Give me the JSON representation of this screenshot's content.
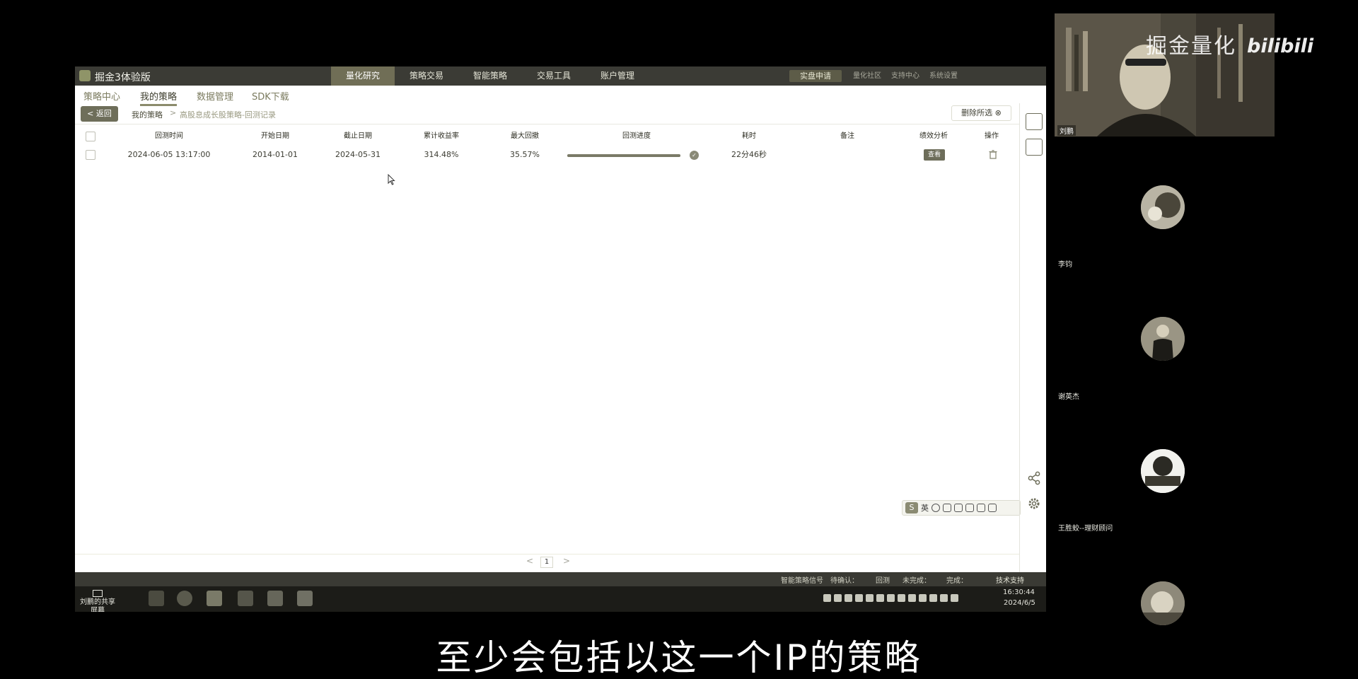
{
  "app": {
    "title": "掘金3体验版",
    "top_tabs": [
      "量化研究",
      "策略交易",
      "智能策略",
      "交易工具",
      "账户管理"
    ],
    "active_top_tab": 0,
    "live_button": "实盘申请",
    "top_links": [
      "量化社区",
      "支持中心",
      "系统设置"
    ]
  },
  "subnav": {
    "items": [
      "策略中心",
      "我的策略",
      "数据管理",
      "SDK下载"
    ],
    "active": 1
  },
  "breadcrumb": {
    "back_label": "< 返回",
    "my_strategy": "我的策略",
    "separator": ">",
    "current": "高股息成长股策略-回测记录",
    "delete_selected": "删除所选 ⊗"
  },
  "table": {
    "headers": [
      "回测时间",
      "开始日期",
      "截止日期",
      "累计收益率",
      "最大回撤",
      "回测进度",
      "耗时",
      "备注",
      "绩效分析",
      "操作"
    ],
    "rows": [
      {
        "backtest_time": "2024-06-05 13:17:00",
        "start_date": "2014-01-01",
        "end_date": "2024-05-31",
        "cumulative_return": "314.48%",
        "max_drawdown": "35.57%",
        "progress": 1.0,
        "elapsed": "22分46秒",
        "note": "",
        "view_label": "查看"
      }
    ]
  },
  "pager": {
    "prev": "<",
    "current": "1",
    "next": ">"
  },
  "statusbar": {
    "items": [
      "智能策略信号",
      "待确认：",
      "回测",
      "未完成：",
      "完成："
    ],
    "tech_support": "技术支持"
  },
  "taskbar": {
    "screenshare_label": "刘鹏的共享屏幕",
    "time": "16:30:44",
    "date": "2024/6/5"
  },
  "ime": {
    "logo": "S",
    "mode": "英"
  },
  "video": {
    "host_name": "刘鹏",
    "watermark": "掘金量化",
    "brand": "bilibili",
    "participants": [
      "李钧",
      "谢英杰",
      "王胜蛟--理财顾问",
      ""
    ]
  },
  "subtitle": "至少会包括以这一个IP的策略",
  "colors": {
    "titlebar": "#3b3b35",
    "accent": "#6e6e5a",
    "background": "#000000"
  }
}
